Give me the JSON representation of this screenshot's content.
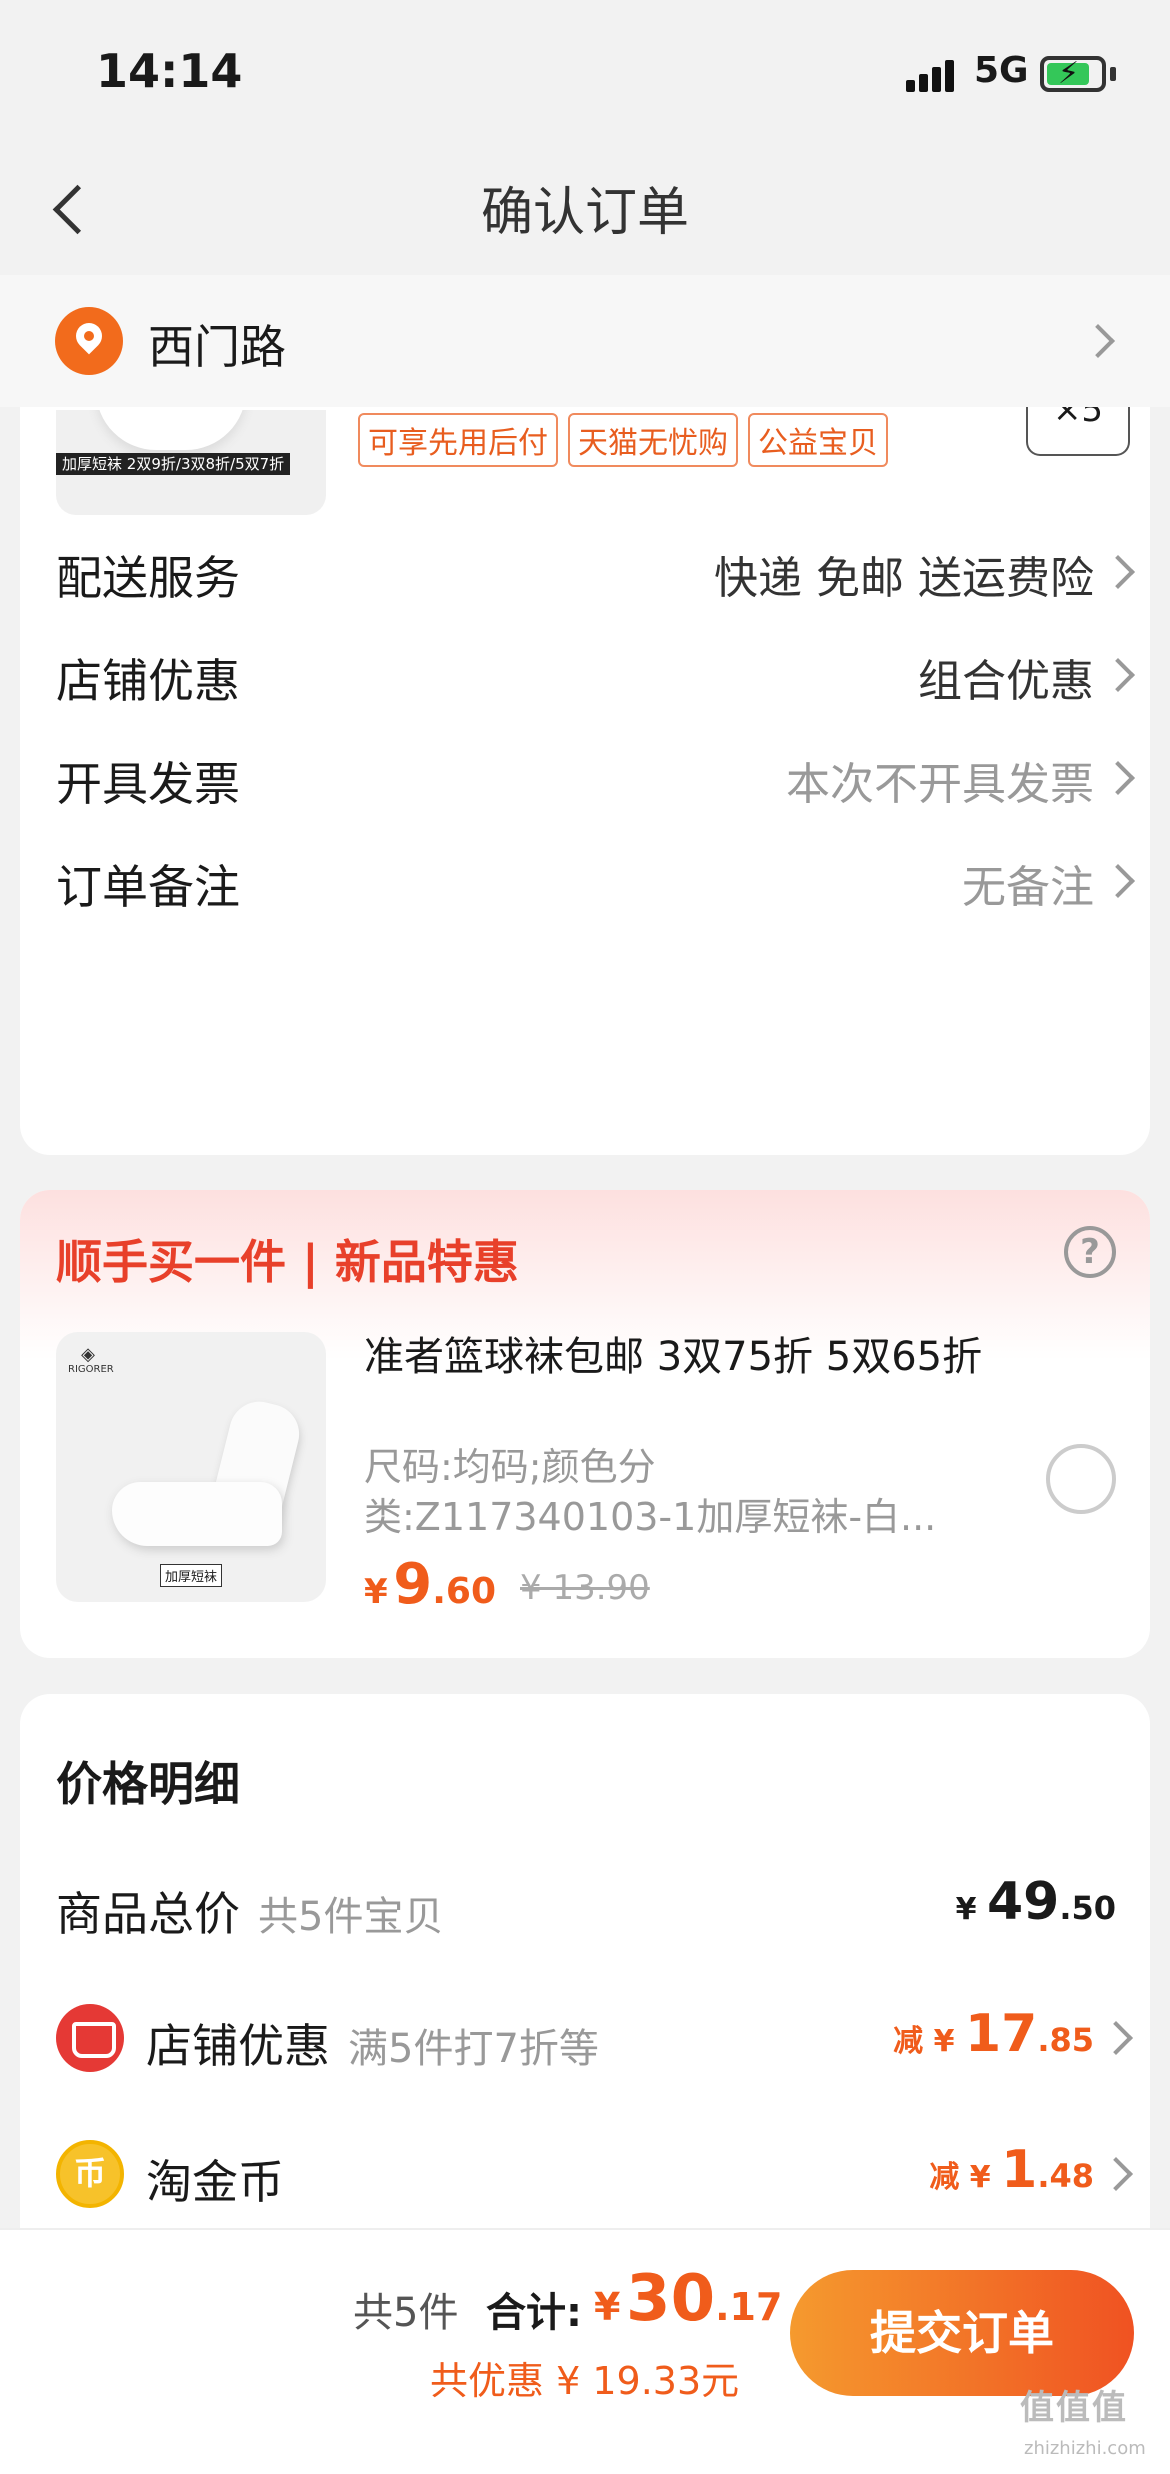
{
  "status": {
    "time": "14:14",
    "network": "5G"
  },
  "nav": {
    "title": "确认订单"
  },
  "address": {
    "text": "西门路"
  },
  "order_item": {
    "thumb_caption_a": "加厚短袜",
    "thumb_caption_b": "2双9折/3双8折/5双7折",
    "tags": [
      "可享先用后付",
      "天猫无忧购",
      "公益宝贝"
    ],
    "quantity": "×5"
  },
  "options": [
    {
      "label": "配送服务",
      "value": "快递 免邮 送运费险"
    },
    {
      "label": "店铺优惠",
      "value": "组合优惠"
    },
    {
      "label": "开具发票",
      "value": "本次不开具发票"
    },
    {
      "label": "订单备注",
      "value": "无备注"
    }
  ],
  "addon": {
    "heading": "顺手买一件 | 新品特惠",
    "logo": "RIGORER",
    "badge": "加厚短袜",
    "title": "准者篮球袜包邮 3双75折 5双65折",
    "spec_line1": "尺码:均码;颜色分",
    "spec_line2": "类:Z117340103-1加厚短袜-白...",
    "price_currency": "¥",
    "price_int": "9",
    "price_dec": ".60",
    "original_price": "¥ 13.90"
  },
  "price_detail": {
    "heading": "价格明细",
    "goods": {
      "label": "商品总价",
      "sub": "共5件宝贝",
      "currency": "¥",
      "int": "49",
      "dec": ".50"
    },
    "shop_discount": {
      "label": "店铺优惠",
      "sub": "满5件打7折等",
      "prefix": "减 ¥",
      "int": "17",
      "dec": ".85"
    },
    "coins": {
      "label": "淘金币",
      "prefix": "减 ¥",
      "int": "1",
      "dec": ".48"
    }
  },
  "footer": {
    "count": "共5件",
    "total_label": "合计:",
    "currency": "¥",
    "total_int": "30",
    "total_dec": ".17",
    "saved": "共优惠 ¥ 19.33元",
    "submit": "提交订单"
  },
  "watermark": {
    "main": "值值值",
    "sub": "zhizhizhi.com"
  }
}
